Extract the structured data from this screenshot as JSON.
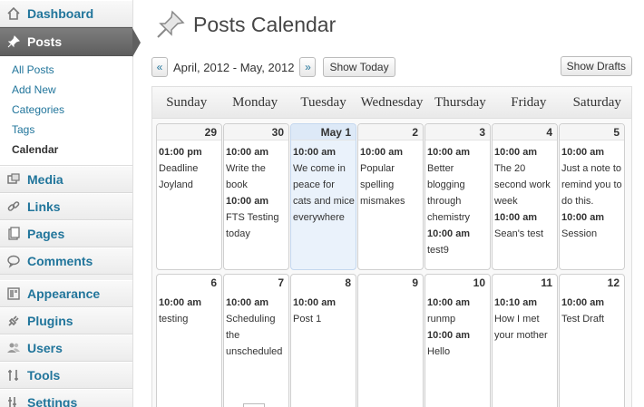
{
  "sidebar": {
    "dashboard": "Dashboard",
    "posts": "Posts",
    "submenu": [
      "All Posts",
      "Add New",
      "Categories",
      "Tags",
      "Calendar"
    ],
    "media": "Media",
    "links": "Links",
    "pages": "Pages",
    "comments": "Comments",
    "appearance": "Appearance",
    "plugins": "Plugins",
    "users": "Users",
    "tools": "Tools",
    "settings": "Settings"
  },
  "page": {
    "title": "Posts Calendar"
  },
  "nav": {
    "prev": "«",
    "next": "»",
    "range": "April, 2012 - May, 2012",
    "show_today": "Show Today",
    "show_drafts": "Show Drafts"
  },
  "calendar": {
    "weekdays": [
      "Sunday",
      "Monday",
      "Tuesday",
      "Wednesday",
      "Thursday",
      "Friday",
      "Saturday"
    ],
    "weeks": [
      [
        {
          "num": "29",
          "posts": [
            {
              "time": "01:00 pm",
              "title": "Deadline Joyland"
            }
          ]
        },
        {
          "num": "30",
          "posts": [
            {
              "time": "10:00 am",
              "title": "Write the book"
            },
            {
              "time": "10:00 am",
              "title": "FTS Testing today"
            }
          ]
        },
        {
          "num": "May 1",
          "today": true,
          "posts": [
            {
              "time": "10:00 am",
              "title": "We come in peace for cats and mice everywhere"
            }
          ]
        },
        {
          "num": "2",
          "posts": [
            {
              "time": "10:00 am",
              "title": "Popular spelling mismakes"
            }
          ]
        },
        {
          "num": "3",
          "posts": [
            {
              "time": "10:00 am",
              "title": "Better blogging through chemistry"
            },
            {
              "time": "10:00 am",
              "title": "test9"
            }
          ]
        },
        {
          "num": "4",
          "posts": [
            {
              "time": "10:00 am",
              "title": "The 20 second work week"
            },
            {
              "time": "10:00 am",
              "title": "Sean's test"
            }
          ]
        },
        {
          "num": "5",
          "posts": [
            {
              "time": "10:00 am",
              "title": "Just a note to remind you to do this."
            },
            {
              "time": "10:00 am",
              "title": "Session"
            }
          ]
        }
      ],
      [
        {
          "num": "6",
          "posts": [
            {
              "time": "10:00 am",
              "title": "testing"
            }
          ]
        },
        {
          "num": "7",
          "posts": [
            {
              "time": "10:00 am",
              "title": "Scheduling the unscheduled"
            }
          ]
        },
        {
          "num": "8",
          "posts": [
            {
              "time": "10:00 am",
              "title": "Post 1"
            }
          ]
        },
        {
          "num": "9",
          "posts": []
        },
        {
          "num": "10",
          "posts": [
            {
              "time": "10:00 am",
              "title": "runmp"
            },
            {
              "time": "10:00 am",
              "title": "Hello"
            }
          ]
        },
        {
          "num": "11",
          "posts": [
            {
              "time": "10:10 am",
              "title": "How I met your mother"
            }
          ]
        },
        {
          "num": "12",
          "posts": [
            {
              "time": "10:00 am",
              "title": "Test Draft"
            }
          ]
        }
      ]
    ]
  }
}
